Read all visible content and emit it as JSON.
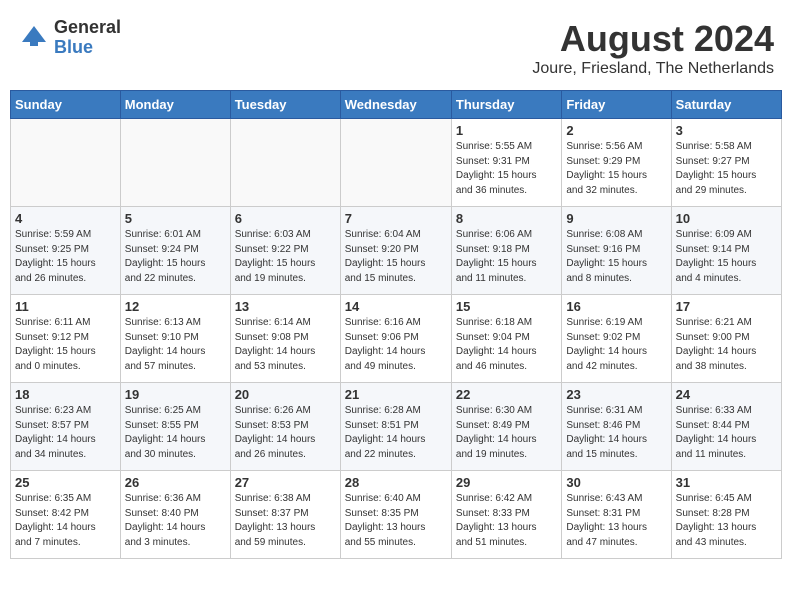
{
  "logo": {
    "general": "General",
    "blue": "Blue"
  },
  "title": "August 2024",
  "location": "Joure, Friesland, The Netherlands",
  "days_of_week": [
    "Sunday",
    "Monday",
    "Tuesday",
    "Wednesday",
    "Thursday",
    "Friday",
    "Saturday"
  ],
  "weeks": [
    [
      {
        "day": "",
        "info": ""
      },
      {
        "day": "",
        "info": ""
      },
      {
        "day": "",
        "info": ""
      },
      {
        "day": "",
        "info": ""
      },
      {
        "day": "1",
        "info": "Sunrise: 5:55 AM\nSunset: 9:31 PM\nDaylight: 15 hours\nand 36 minutes."
      },
      {
        "day": "2",
        "info": "Sunrise: 5:56 AM\nSunset: 9:29 PM\nDaylight: 15 hours\nand 32 minutes."
      },
      {
        "day": "3",
        "info": "Sunrise: 5:58 AM\nSunset: 9:27 PM\nDaylight: 15 hours\nand 29 minutes."
      }
    ],
    [
      {
        "day": "4",
        "info": "Sunrise: 5:59 AM\nSunset: 9:25 PM\nDaylight: 15 hours\nand 26 minutes."
      },
      {
        "day": "5",
        "info": "Sunrise: 6:01 AM\nSunset: 9:24 PM\nDaylight: 15 hours\nand 22 minutes."
      },
      {
        "day": "6",
        "info": "Sunrise: 6:03 AM\nSunset: 9:22 PM\nDaylight: 15 hours\nand 19 minutes."
      },
      {
        "day": "7",
        "info": "Sunrise: 6:04 AM\nSunset: 9:20 PM\nDaylight: 15 hours\nand 15 minutes."
      },
      {
        "day": "8",
        "info": "Sunrise: 6:06 AM\nSunset: 9:18 PM\nDaylight: 15 hours\nand 11 minutes."
      },
      {
        "day": "9",
        "info": "Sunrise: 6:08 AM\nSunset: 9:16 PM\nDaylight: 15 hours\nand 8 minutes."
      },
      {
        "day": "10",
        "info": "Sunrise: 6:09 AM\nSunset: 9:14 PM\nDaylight: 15 hours\nand 4 minutes."
      }
    ],
    [
      {
        "day": "11",
        "info": "Sunrise: 6:11 AM\nSunset: 9:12 PM\nDaylight: 15 hours\nand 0 minutes."
      },
      {
        "day": "12",
        "info": "Sunrise: 6:13 AM\nSunset: 9:10 PM\nDaylight: 14 hours\nand 57 minutes."
      },
      {
        "day": "13",
        "info": "Sunrise: 6:14 AM\nSunset: 9:08 PM\nDaylight: 14 hours\nand 53 minutes."
      },
      {
        "day": "14",
        "info": "Sunrise: 6:16 AM\nSunset: 9:06 PM\nDaylight: 14 hours\nand 49 minutes."
      },
      {
        "day": "15",
        "info": "Sunrise: 6:18 AM\nSunset: 9:04 PM\nDaylight: 14 hours\nand 46 minutes."
      },
      {
        "day": "16",
        "info": "Sunrise: 6:19 AM\nSunset: 9:02 PM\nDaylight: 14 hours\nand 42 minutes."
      },
      {
        "day": "17",
        "info": "Sunrise: 6:21 AM\nSunset: 9:00 PM\nDaylight: 14 hours\nand 38 minutes."
      }
    ],
    [
      {
        "day": "18",
        "info": "Sunrise: 6:23 AM\nSunset: 8:57 PM\nDaylight: 14 hours\nand 34 minutes."
      },
      {
        "day": "19",
        "info": "Sunrise: 6:25 AM\nSunset: 8:55 PM\nDaylight: 14 hours\nand 30 minutes."
      },
      {
        "day": "20",
        "info": "Sunrise: 6:26 AM\nSunset: 8:53 PM\nDaylight: 14 hours\nand 26 minutes."
      },
      {
        "day": "21",
        "info": "Sunrise: 6:28 AM\nSunset: 8:51 PM\nDaylight: 14 hours\nand 22 minutes."
      },
      {
        "day": "22",
        "info": "Sunrise: 6:30 AM\nSunset: 8:49 PM\nDaylight: 14 hours\nand 19 minutes."
      },
      {
        "day": "23",
        "info": "Sunrise: 6:31 AM\nSunset: 8:46 PM\nDaylight: 14 hours\nand 15 minutes."
      },
      {
        "day": "24",
        "info": "Sunrise: 6:33 AM\nSunset: 8:44 PM\nDaylight: 14 hours\nand 11 minutes."
      }
    ],
    [
      {
        "day": "25",
        "info": "Sunrise: 6:35 AM\nSunset: 8:42 PM\nDaylight: 14 hours\nand 7 minutes."
      },
      {
        "day": "26",
        "info": "Sunrise: 6:36 AM\nSunset: 8:40 PM\nDaylight: 14 hours\nand 3 minutes."
      },
      {
        "day": "27",
        "info": "Sunrise: 6:38 AM\nSunset: 8:37 PM\nDaylight: 13 hours\nand 59 minutes."
      },
      {
        "day": "28",
        "info": "Sunrise: 6:40 AM\nSunset: 8:35 PM\nDaylight: 13 hours\nand 55 minutes."
      },
      {
        "day": "29",
        "info": "Sunrise: 6:42 AM\nSunset: 8:33 PM\nDaylight: 13 hours\nand 51 minutes."
      },
      {
        "day": "30",
        "info": "Sunrise: 6:43 AM\nSunset: 8:31 PM\nDaylight: 13 hours\nand 47 minutes."
      },
      {
        "day": "31",
        "info": "Sunrise: 6:45 AM\nSunset: 8:28 PM\nDaylight: 13 hours\nand 43 minutes."
      }
    ]
  ]
}
